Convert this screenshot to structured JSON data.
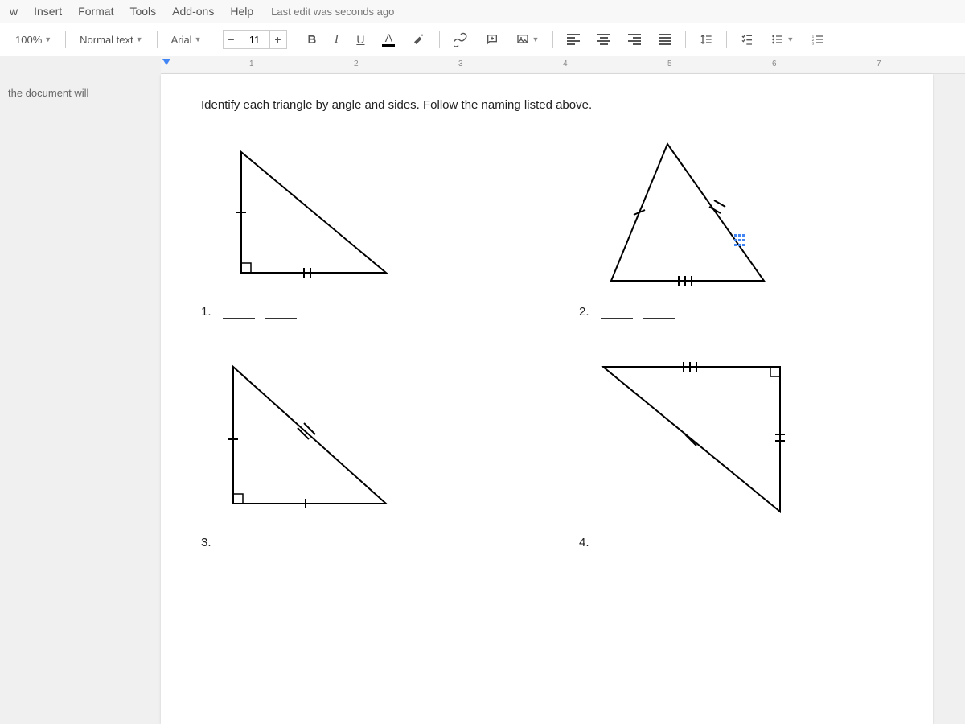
{
  "menu": {
    "items": [
      "w",
      "Insert",
      "Format",
      "Tools",
      "Add-ons",
      "Help"
    ],
    "edit_status": "Last edit was seconds ago"
  },
  "toolbar": {
    "zoom": "100%",
    "style": "Normal text",
    "font": "Arial",
    "font_size": "11",
    "bold": "B",
    "italic": "I",
    "underline": "U",
    "text_color": "A"
  },
  "ruler": {
    "ticks": [
      "1",
      "2",
      "3",
      "4",
      "5",
      "6",
      "7"
    ]
  },
  "outline": {
    "text": "the document will"
  },
  "doc": {
    "instruction": "Identify each triangle by angle and sides. Follow the naming listed above.",
    "answers": [
      {
        "num": "1."
      },
      {
        "num": "2."
      },
      {
        "num": "3."
      },
      {
        "num": "4."
      }
    ]
  }
}
